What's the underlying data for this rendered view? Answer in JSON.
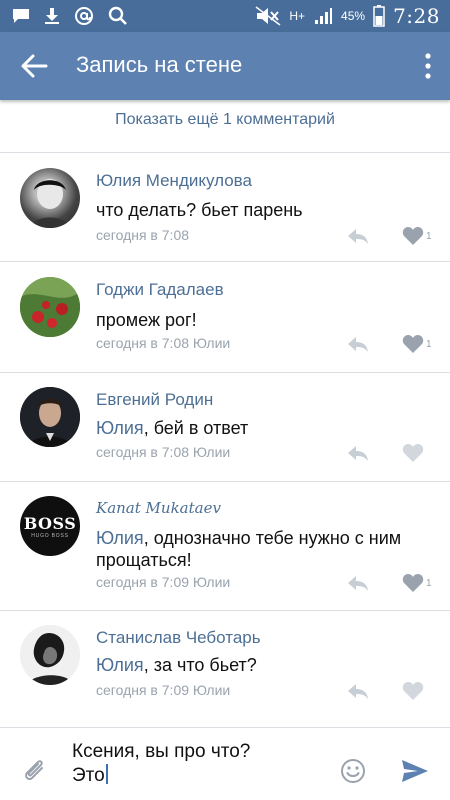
{
  "status_bar": {
    "network": "H+",
    "battery": "45%",
    "time": "7:28",
    "icons": [
      "message-icon",
      "download-icon",
      "at-icon",
      "search-icon",
      "mute-icon",
      "signal-icon",
      "battery-icon"
    ]
  },
  "toolbar": {
    "title": "Запись на стене",
    "back_icon": "arrow-left-icon",
    "menu_icon": "more-vert-icon"
  },
  "show_more": {
    "label": "Показать ещё 1 комментарий"
  },
  "comments": [
    {
      "author": "Юлия Мендикулова",
      "text": "что делать? бьет парень",
      "meta": "сегодня в 7:08",
      "likes": "1"
    },
    {
      "author": "Годжи Гадалаев",
      "text": "промеж рог!",
      "meta": "сегодня в 7:08 Юлии",
      "likes": "1"
    },
    {
      "author": "Евгений Родин",
      "mention": "Юлия",
      "text": ", бей в ответ",
      "meta": "сегодня в 7:08 Юлии",
      "likes": ""
    },
    {
      "author": "Kanat Mukataev",
      "mention": "Юлия",
      "text": ", однозначно тебе нужно с ним прощаться!",
      "meta": "сегодня в 7:09 Юлии",
      "likes": "1",
      "avatar_text": "BOSS",
      "avatar_subtext": "HUGO BOSS"
    },
    {
      "author": "Станислав Чеботарь",
      "mention": "Юлия",
      "text": ", за что бьет?",
      "meta": "сегодня в 7:09 Юлии",
      "likes": ""
    }
  ],
  "input": {
    "value_line1": "Ксения, вы про что?",
    "value_line2": "Это"
  },
  "colors": {
    "status_bar": "#486d9a",
    "toolbar": "#5d82b1",
    "link": "#4d6f95",
    "meta": "#9aa3ad",
    "send": "#5d82b1"
  }
}
